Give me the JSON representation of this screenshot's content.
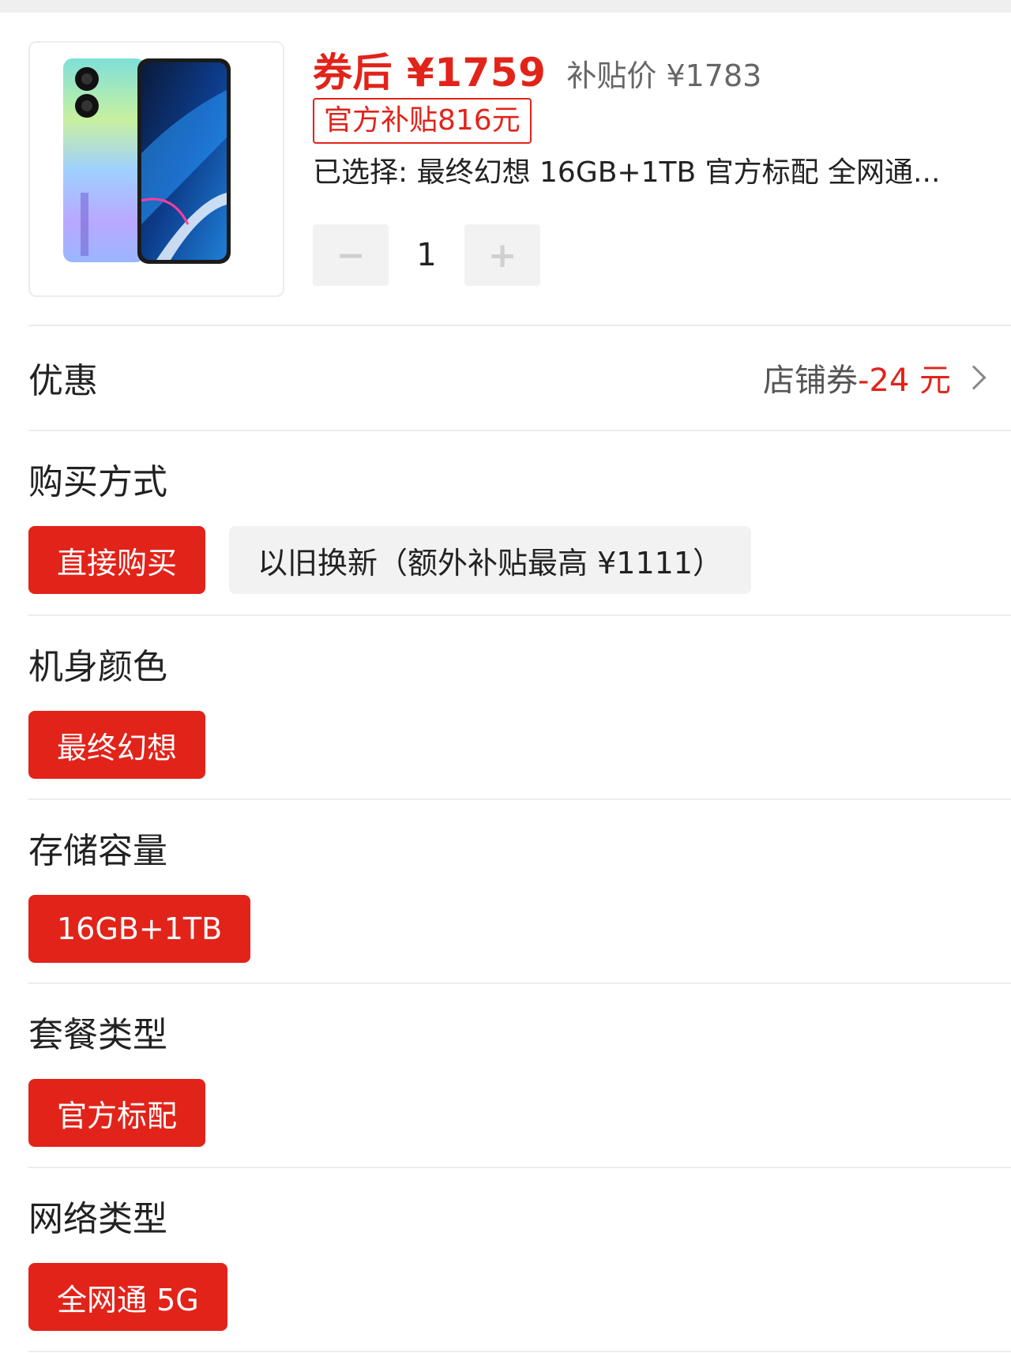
{
  "product": {
    "price_label": "券后 ¥1759",
    "subsidy_price_label": "补贴价 ¥1783",
    "subsidy_badge": "官方补贴816元",
    "selected_text": "已选择: 最终幻想 16GB+1TB 官方标配 全网通...",
    "quantity": "1",
    "decrement_symbol": "−",
    "increment_symbol": "+"
  },
  "discount": {
    "title": "优惠",
    "coupon_label": "店铺券",
    "coupon_amount": "-24 元"
  },
  "sections": {
    "purchase_method": {
      "title": "购买方式",
      "options": [
        "直接购买",
        "以旧换新（额外补贴最高 ¥1111）"
      ]
    },
    "color": {
      "title": "机身颜色",
      "options": [
        "最终幻想"
      ]
    },
    "storage": {
      "title": "存储容量",
      "options": [
        "16GB+1TB"
      ]
    },
    "package": {
      "title": "套餐类型",
      "options": [
        "官方标配"
      ]
    },
    "network": {
      "title": "网络类型",
      "options": [
        "全网通 5G"
      ]
    }
  },
  "colors": {
    "accent": "#e2231a",
    "inactive_bg": "#f2f2f2",
    "divider": "#ededed"
  },
  "icons": {
    "chevron": "chevron-right-icon",
    "phone_image": "phone-product-image"
  }
}
